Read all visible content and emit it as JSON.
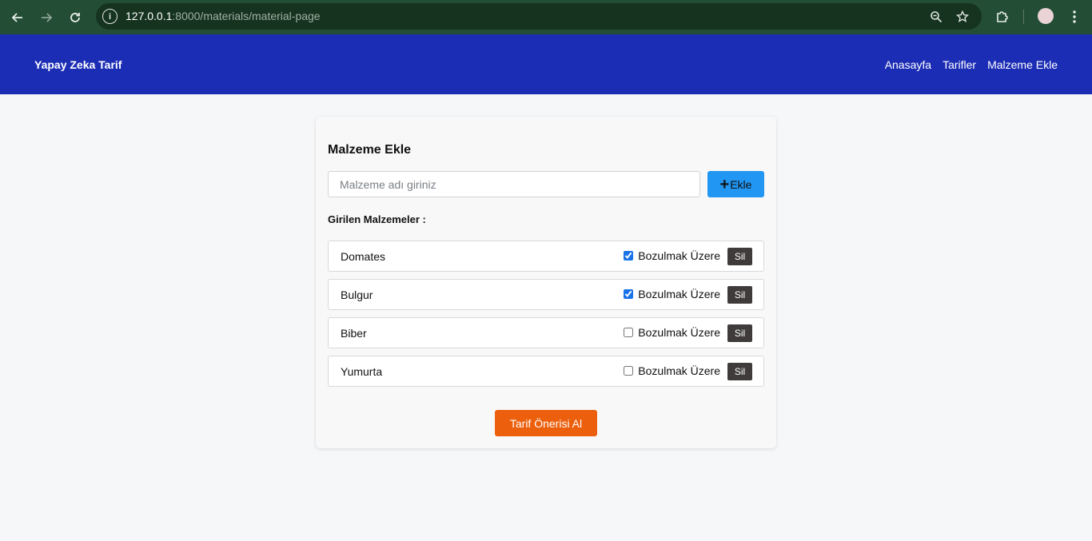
{
  "browser": {
    "url_host": "127.0.0.1",
    "url_rest": ":8000/materials/material-page"
  },
  "navbar": {
    "brand": "Yapay Zeka Tarif",
    "links": [
      "Anasayfa",
      "Tarifler",
      "Malzeme Ekle"
    ],
    "background": "#1c2db5"
  },
  "card": {
    "title": "Malzeme Ekle",
    "input_placeholder": "Malzeme adı giriniz",
    "input_value": "",
    "add_button_label": "Ekle",
    "list_label": "Girilen Malzemeler :",
    "suggest_button_label": "Tarif Önerisi Al"
  },
  "materials": [
    {
      "name": "Domates",
      "spoiling_label": "Bozulmak Üzere",
      "spoiling": true,
      "delete_label": "Sil"
    },
    {
      "name": "Bulgur",
      "spoiling_label": "Bozulmak Üzere",
      "spoiling": true,
      "delete_label": "Sil"
    },
    {
      "name": "Biber",
      "spoiling_label": "Bozulmak Üzere",
      "spoiling": false,
      "delete_label": "Sil"
    },
    {
      "name": "Yumurta",
      "spoiling_label": "Bozulmak Üzere",
      "spoiling": false,
      "delete_label": "Sil"
    }
  ],
  "colors": {
    "add_button": "#2196f3",
    "suggest_button": "#ec5f0c",
    "delete_button": "#3f3b3b"
  },
  "icons": {
    "back": "back-arrow-icon",
    "forward": "forward-arrow-icon",
    "reload": "reload-icon",
    "site_info": "info-icon",
    "zoom": "zoom-icon",
    "bookmark": "star-icon",
    "extensions": "puzzle-icon",
    "menu": "kebab-menu-icon",
    "add": "plus-icon"
  }
}
